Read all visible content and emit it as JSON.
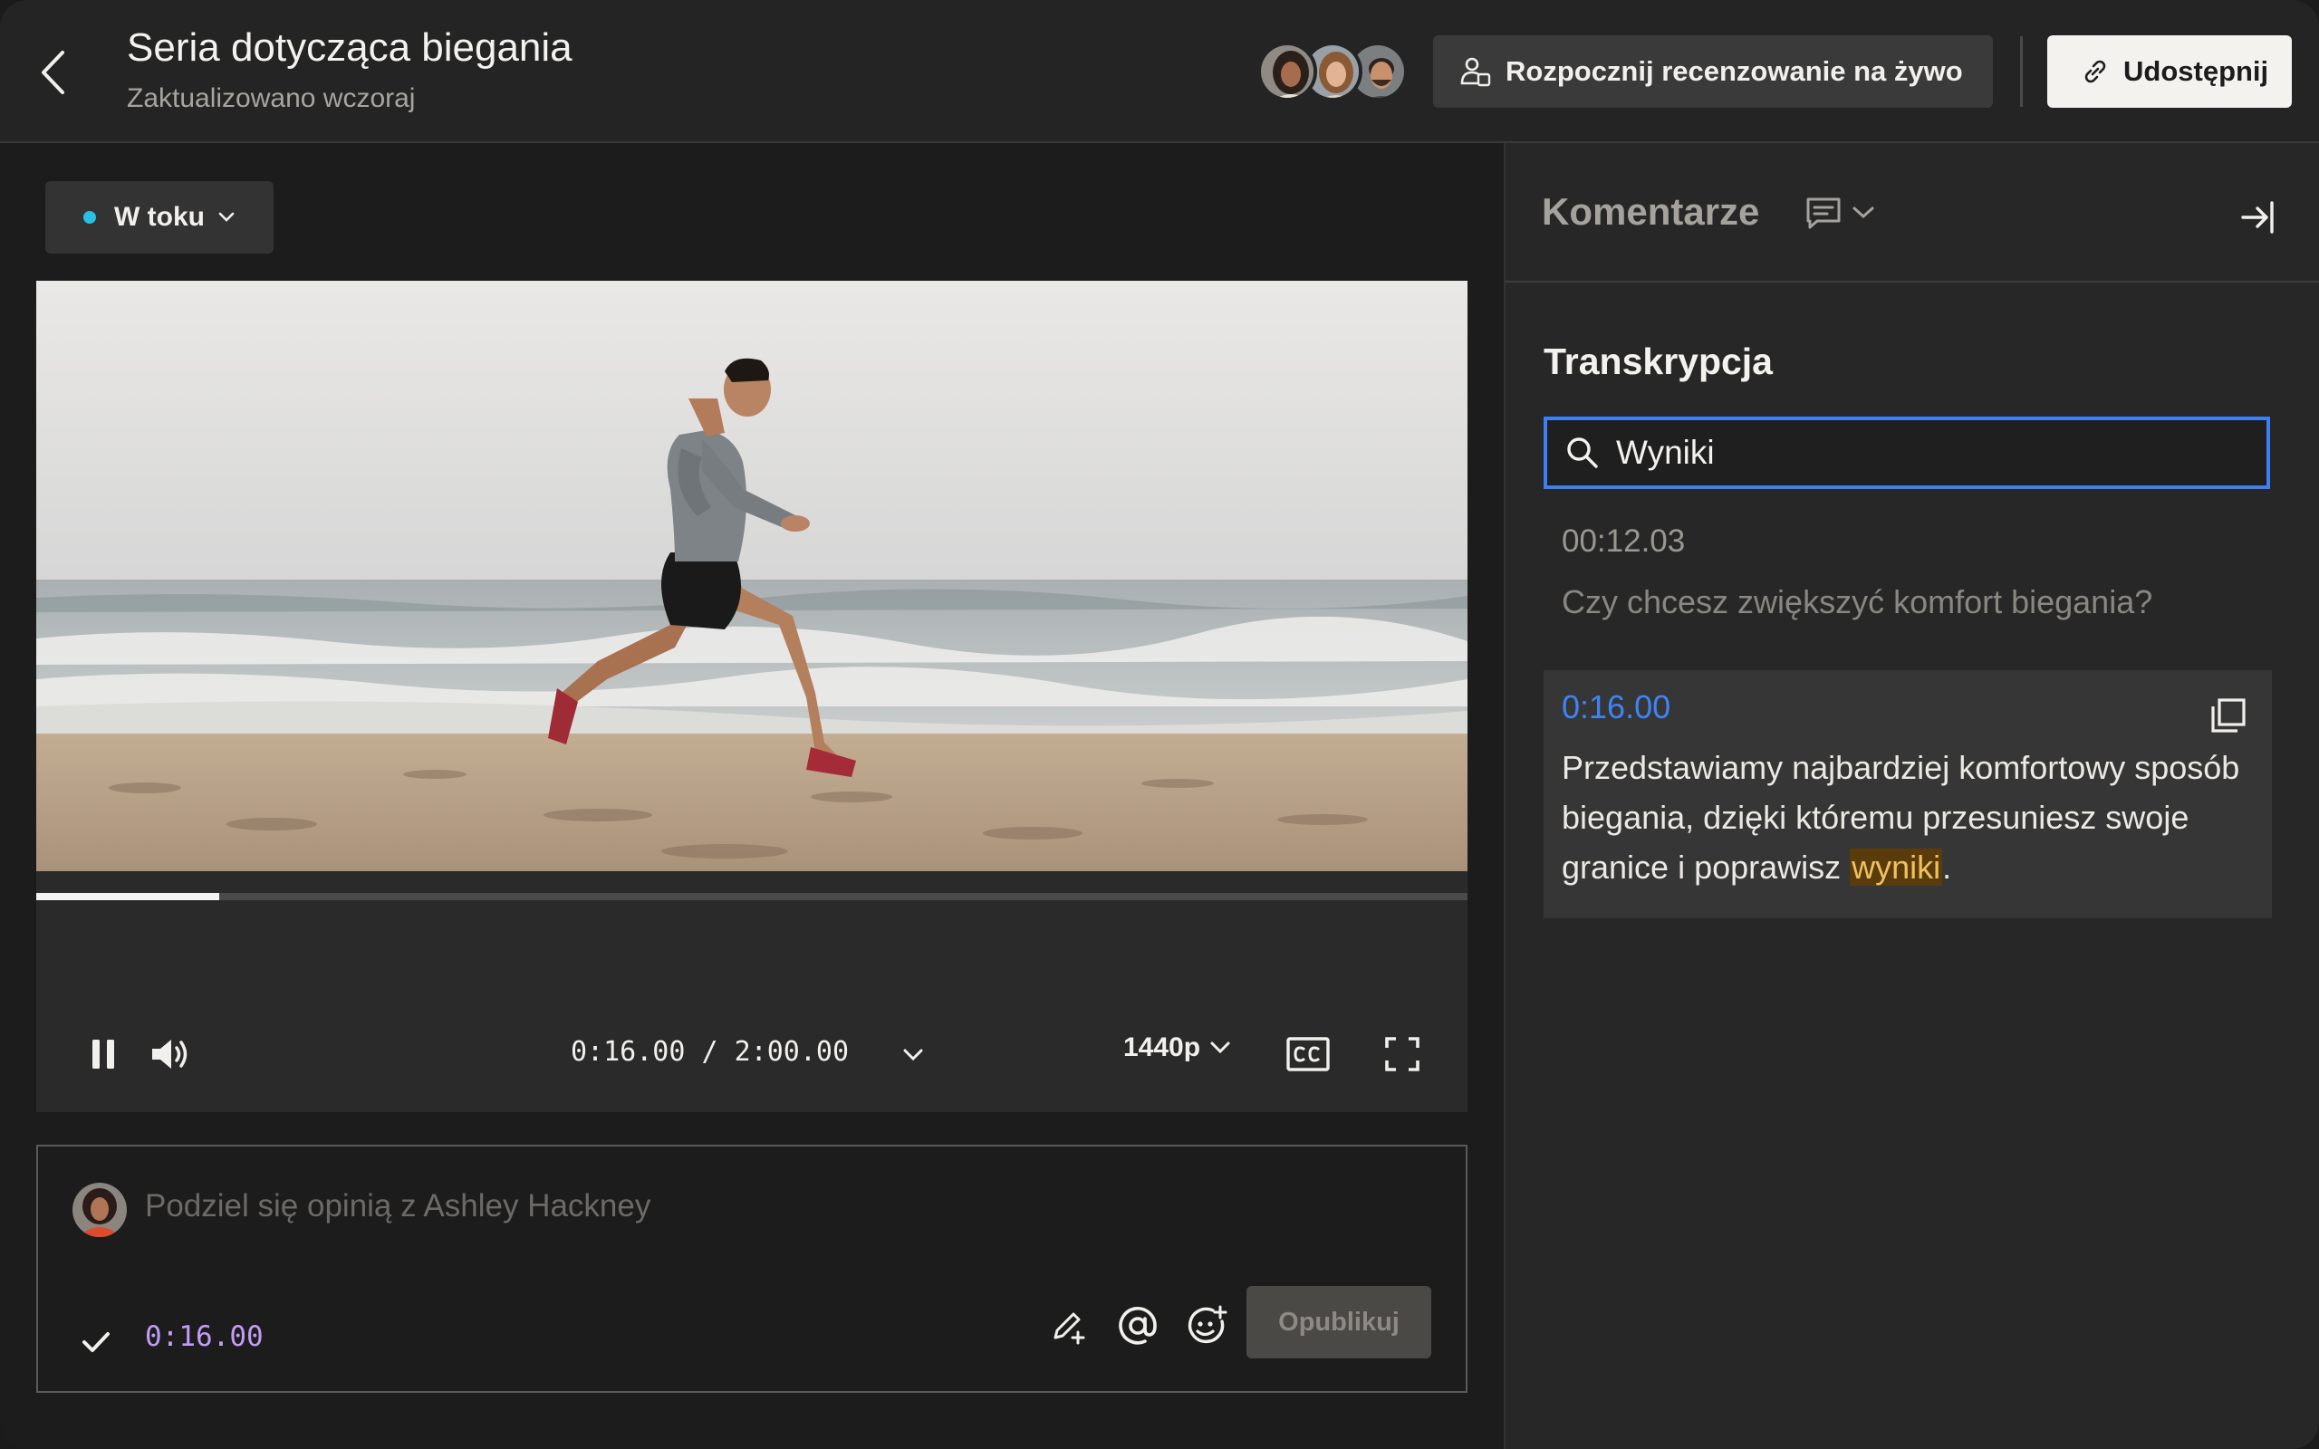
{
  "header": {
    "title": "Seria dotycząca biegania",
    "subtitle": "Zaktualizowano wczoraj",
    "live_review_label": "Rozpocznij recenzowanie na żywo",
    "share_label": "Udostępnij"
  },
  "status": {
    "label": "W toku",
    "dot_color": "#28c0e8"
  },
  "player": {
    "current_time": "0:16.00",
    "duration": "2:00.00",
    "time_separator": " / ",
    "progress": 0.128,
    "quality": "1440p",
    "icons": [
      "pause-icon",
      "volume-icon",
      "chevron-down-icon",
      "cc-icon",
      "fullscreen-icon"
    ]
  },
  "comment": {
    "placeholder": "Podziel się opinią z Ashley Hackney",
    "timestamp": "0:16.00",
    "publish_label": "Opublikuj"
  },
  "panel": {
    "title": "Komentarze",
    "section_title": "Transkrypcja",
    "search_value": "Wyniki",
    "entries": [
      {
        "time": "00:12.03",
        "text": "Czy chcesz zwiększyć komfort biegania?"
      },
      {
        "time": "0:16.00",
        "text_before": "Przedstawiamy najbardziej komfortowy sposób biegania, dzięki któremu przesuniesz swoje granice i poprawisz ",
        "highlight": "wyniki",
        "text_after": "."
      }
    ]
  },
  "colors": {
    "accent": "#3e7ff3",
    "timestamp_purple": "#c19cf4",
    "highlight": "#5a3c0c"
  }
}
